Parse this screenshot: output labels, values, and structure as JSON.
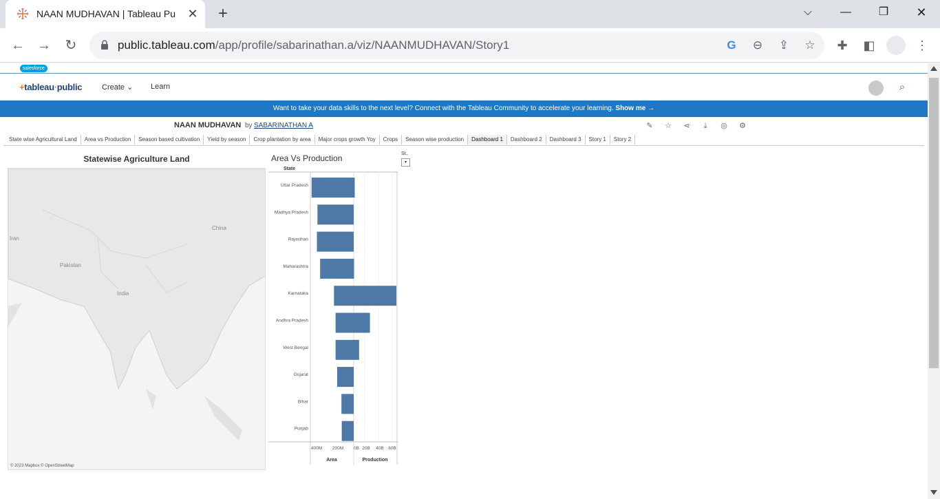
{
  "browser": {
    "tab_title": "NAAN MUDHAVAN | Tableau Pu",
    "url_host": "public.tableau.com",
    "url_path": "/app/profile/sabarinathan.a/viz/NAANMUDHAVAN/Story1"
  },
  "site": {
    "salesforce": "salesforce",
    "logo_prefix": "+",
    "logo_main": "tableau",
    "logo_suffix": "public",
    "nav_create": "Create",
    "nav_learn": "Learn",
    "banner_text": "Want to take your data skills to the next level? Connect with the Tableau Community to accelerate your learning.",
    "banner_link": "Show me →"
  },
  "viz": {
    "title": "NAAN MUDHAVAN",
    "by": "by",
    "author": "SABARINATHAN A",
    "tabs": [
      "State wise Agricultural Land",
      "Area vs Production",
      "Season based cultivation",
      "Yield by season",
      "Crop plantation by area",
      "Major crops growth Yoy",
      "Crops",
      "Season wise production",
      "Dashboard 1",
      "Dashboard 2",
      "Dashboard 3",
      "Story 1",
      "Story 2"
    ],
    "active_tab": "Dashboard 1"
  },
  "map": {
    "title": "Statewise Agriculture Land",
    "labels": {
      "iran": "Iran",
      "pakistan": "Pakistan",
      "india": "India",
      "china": "China"
    },
    "credit": "© 2023 Mapbox © OpenStreetMap"
  },
  "filter": {
    "label": "St..",
    "arrow": "▾"
  },
  "chart_data": {
    "type": "bar",
    "title": "Area Vs Production",
    "row_header": "State",
    "categories": [
      "Uttar Pradesh",
      "Madhya Pradesh",
      "Rajasthan",
      "Maharashtra",
      "Karnataka",
      "Andhra Pradesh",
      "West Bengal",
      "Gujarat",
      "Bihar",
      "Punjab"
    ],
    "series": [
      {
        "name": "Area",
        "values": [
          395000000,
          340000000,
          345000000,
          315000000,
          185000000,
          170000000,
          170000000,
          155000000,
          115000000,
          112000000
        ],
        "ticks": [
          "400M",
          "200M"
        ],
        "max": 400000000
      },
      {
        "name": "Production",
        "values": [
          1500000000,
          0,
          0,
          500000000,
          63000000000,
          24000000000,
          8000000000,
          0,
          0,
          0
        ],
        "ticks": [
          "0B",
          "20B",
          "40B",
          "60B"
        ],
        "max": 63000000000
      }
    ],
    "bar_color": "#4e79a7"
  }
}
